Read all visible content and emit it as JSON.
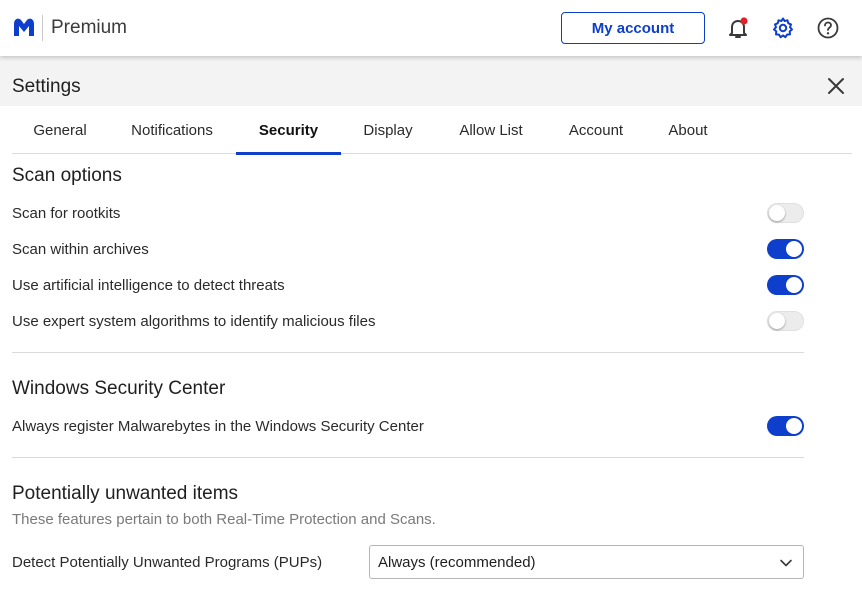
{
  "app": {
    "product": "Premium",
    "my_account_label": "My account",
    "icons": {
      "logo": "malwarebytes-logo",
      "notifications": "bell-icon",
      "settings": "gear-icon",
      "help": "help-icon"
    },
    "colors": {
      "accent": "#0d3ecc",
      "notification_dot": "#e0202a"
    }
  },
  "settings": {
    "title": "Settings",
    "tabs": [
      {
        "label": "General",
        "active": false
      },
      {
        "label": "Notifications",
        "active": false
      },
      {
        "label": "Security",
        "active": true
      },
      {
        "label": "Display",
        "active": false
      },
      {
        "label": "Allow List",
        "active": false
      },
      {
        "label": "Account",
        "active": false
      },
      {
        "label": "About",
        "active": false
      }
    ]
  },
  "scan_options": {
    "title": "Scan options",
    "items": [
      {
        "label": "Scan for rootkits",
        "enabled": false
      },
      {
        "label": "Scan within archives",
        "enabled": true
      },
      {
        "label": "Use artificial intelligence to detect threats",
        "enabled": true
      },
      {
        "label": "Use expert system algorithms to identify malicious files",
        "enabled": false
      }
    ]
  },
  "windows_security_center": {
    "title": "Windows Security Center",
    "items": [
      {
        "label": "Always register Malwarebytes in the Windows Security Center",
        "enabled": true
      }
    ]
  },
  "pups": {
    "title": "Potentially unwanted items",
    "subtitle": "These features pertain to both Real-Time Protection and Scans.",
    "detect_label": "Detect Potentially Unwanted Programs (PUPs)",
    "detect_value": "Always (recommended)"
  }
}
